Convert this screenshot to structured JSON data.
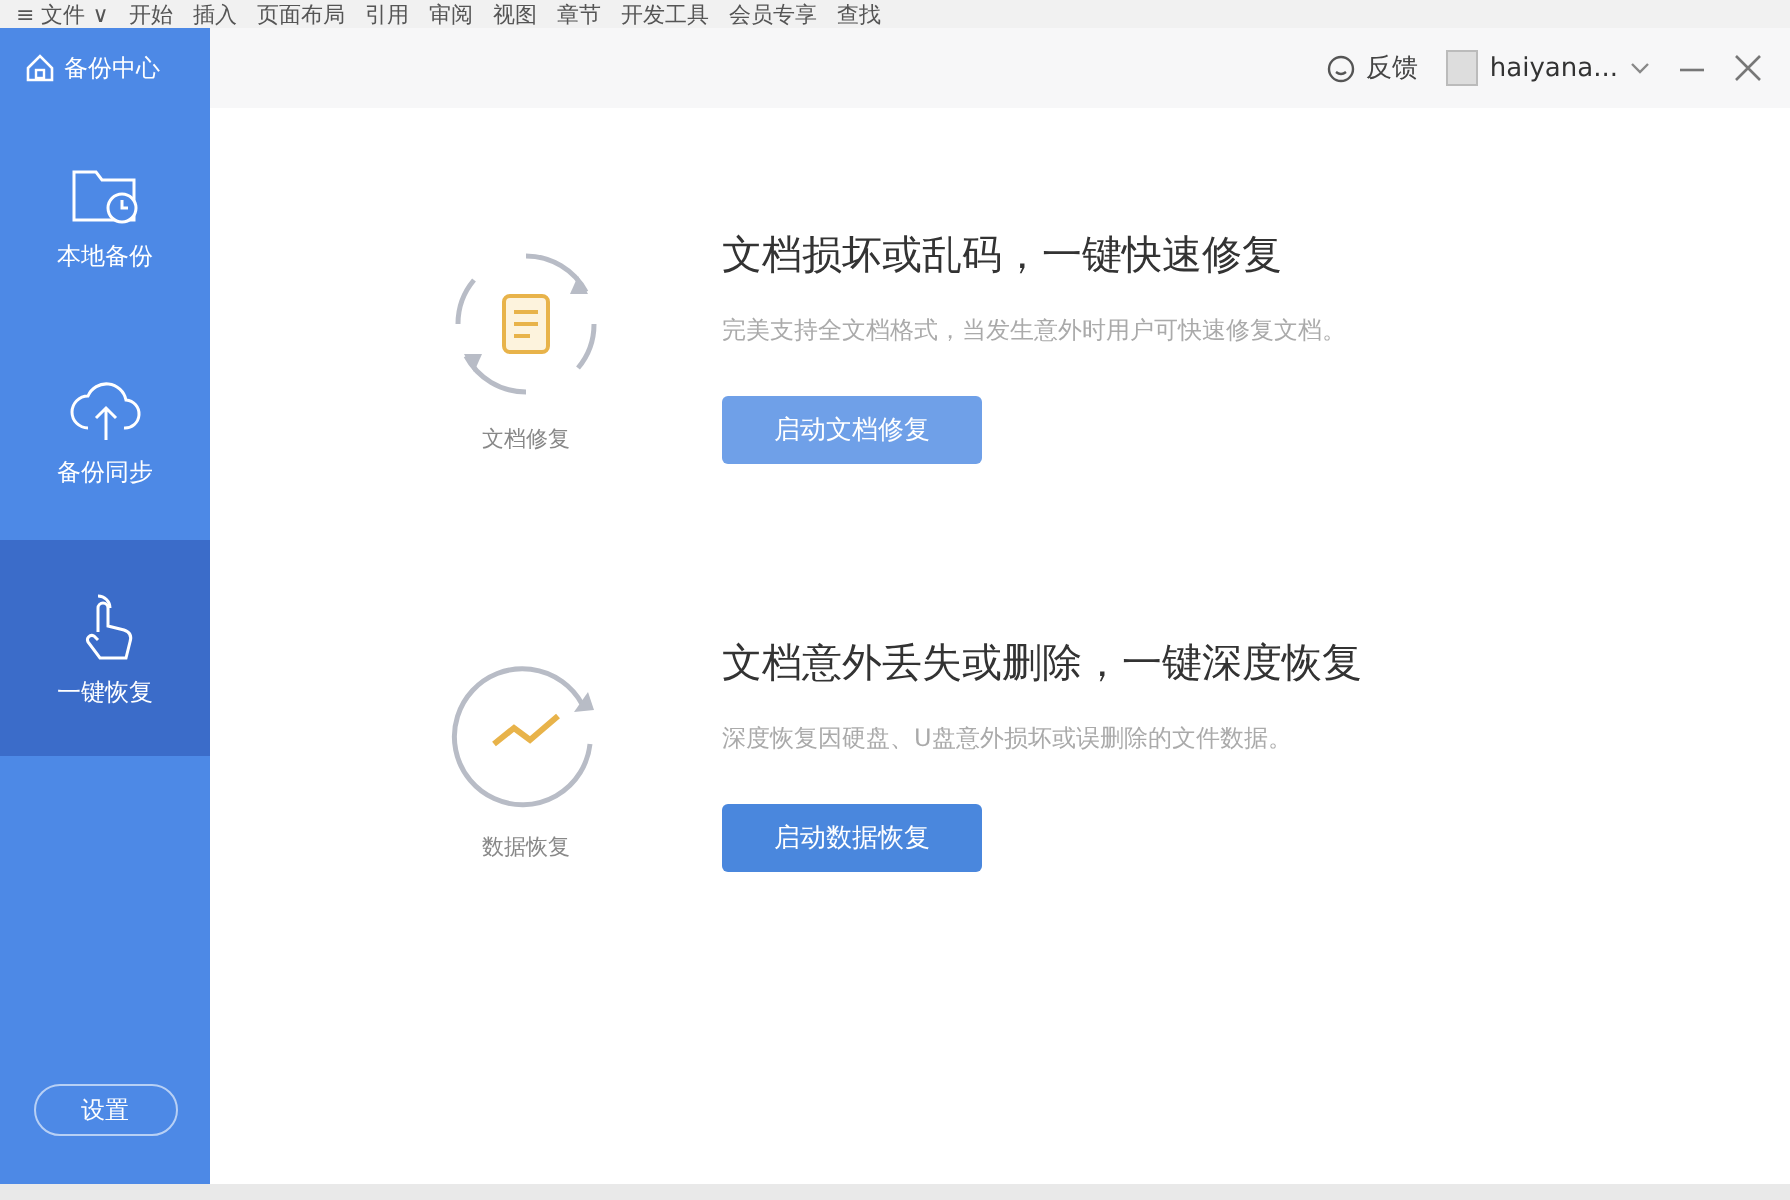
{
  "background_toolbar": {
    "items": [
      "≡ 文件 ∨",
      "开始",
      "插入",
      "页面布局",
      "引用",
      "审阅",
      "视图",
      "章节",
      "开发工具",
      "会员专享",
      "查找"
    ]
  },
  "sidebar": {
    "title": "备份中心",
    "items": [
      {
        "kind": "folder",
        "label": "本地备份",
        "selected": false
      },
      {
        "kind": "cloud",
        "label": "备份同步",
        "selected": false
      },
      {
        "kind": "hand",
        "label": "一键恢复",
        "selected": true
      }
    ],
    "settings_button": "设置"
  },
  "header": {
    "feedback": "反馈",
    "user": "haiyana..."
  },
  "sections": [
    {
      "kind": "document",
      "icon_label": "文档修复",
      "title": "文档损坏或乱码，一键快速修复",
      "description": "完美支持全文档格式，当发生意外时用户可快速修复文档。",
      "button": "启动文档修复",
      "hovered": true
    },
    {
      "kind": "chart",
      "icon_label": "数据恢复",
      "title": "文档意外丢失或删除，一键深度恢复",
      "description": "深度恢复因硬盘、U盘意外损坏或误删除的文件数据。",
      "button": "启动数据恢复",
      "hovered": false
    }
  ]
}
